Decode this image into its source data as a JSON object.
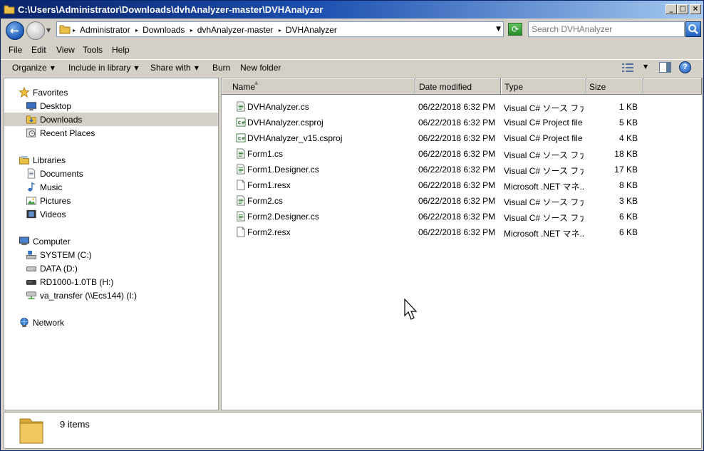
{
  "window": {
    "title": "C:\\Users\\Administrator\\Downloads\\dvhAnalyzer-master\\DVHAnalyzer"
  },
  "address": {
    "crumbs": [
      "Administrator",
      "Downloads",
      "dvhAnalyzer-master",
      "DVHAnalyzer"
    ]
  },
  "search": {
    "placeholder": "Search DVHAnalyzer"
  },
  "menu": {
    "file": "File",
    "edit": "Edit",
    "view": "View",
    "tools": "Tools",
    "help": "Help"
  },
  "toolbar": {
    "organize": "Organize",
    "include_in_library": "Include in library",
    "share_with": "Share with",
    "burn": "Burn",
    "new_folder": "New folder"
  },
  "nav": {
    "favorites": "Favorites",
    "desktop": "Desktop",
    "downloads": "Downloads",
    "recent_places": "Recent Places",
    "libraries": "Libraries",
    "documents": "Documents",
    "music": "Music",
    "pictures": "Pictures",
    "videos": "Videos",
    "computer": "Computer",
    "system_c": "SYSTEM (C:)",
    "data_d": "DATA (D:)",
    "rd1000_h": "RD1000-1.0TB (H:)",
    "va_transfer_i": "va_transfer (\\\\Ecs144) (I:)",
    "network": "Network"
  },
  "columns": {
    "name": "Name",
    "date_modified": "Date modified",
    "type": "Type",
    "size": "Size"
  },
  "files": [
    {
      "name": "DVHAnalyzer.cs",
      "date": "06/22/2018 6:32 PM",
      "type": "Visual C# ソース ファ...",
      "size": "1 KB",
      "icon": "cs"
    },
    {
      "name": "DVHAnalyzer.csproj",
      "date": "06/22/2018 6:32 PM",
      "type": "Visual C# Project file",
      "size": "5 KB",
      "icon": "csproj"
    },
    {
      "name": "DVHAnalyzer_v15.csproj",
      "date": "06/22/2018 6:32 PM",
      "type": "Visual C# Project file",
      "size": "4 KB",
      "icon": "csproj"
    },
    {
      "name": "Form1.cs",
      "date": "06/22/2018 6:32 PM",
      "type": "Visual C# ソース ファ...",
      "size": "18 KB",
      "icon": "cs"
    },
    {
      "name": "Form1.Designer.cs",
      "date": "06/22/2018 6:32 PM",
      "type": "Visual C# ソース ファ...",
      "size": "17 KB",
      "icon": "cs"
    },
    {
      "name": "Form1.resx",
      "date": "06/22/2018 6:32 PM",
      "type": "Microsoft .NET マネ...",
      "size": "8 KB",
      "icon": "resx"
    },
    {
      "name": "Form2.cs",
      "date": "06/22/2018 6:32 PM",
      "type": "Visual C# ソース ファ...",
      "size": "3 KB",
      "icon": "cs"
    },
    {
      "name": "Form2.Designer.cs",
      "date": "06/22/2018 6:32 PM",
      "type": "Visual C# ソース ファ...",
      "size": "6 KB",
      "icon": "cs"
    },
    {
      "name": "Form2.resx",
      "date": "06/22/2018 6:32 PM",
      "type": "Microsoft .NET マネ...",
      "size": "6 KB",
      "icon": "resx"
    }
  ],
  "status": {
    "item_count": "9 items"
  },
  "colors": {
    "title_bar": "#0a246a",
    "selection": "#d4d0c8",
    "window_face": "#d4d0c8"
  }
}
